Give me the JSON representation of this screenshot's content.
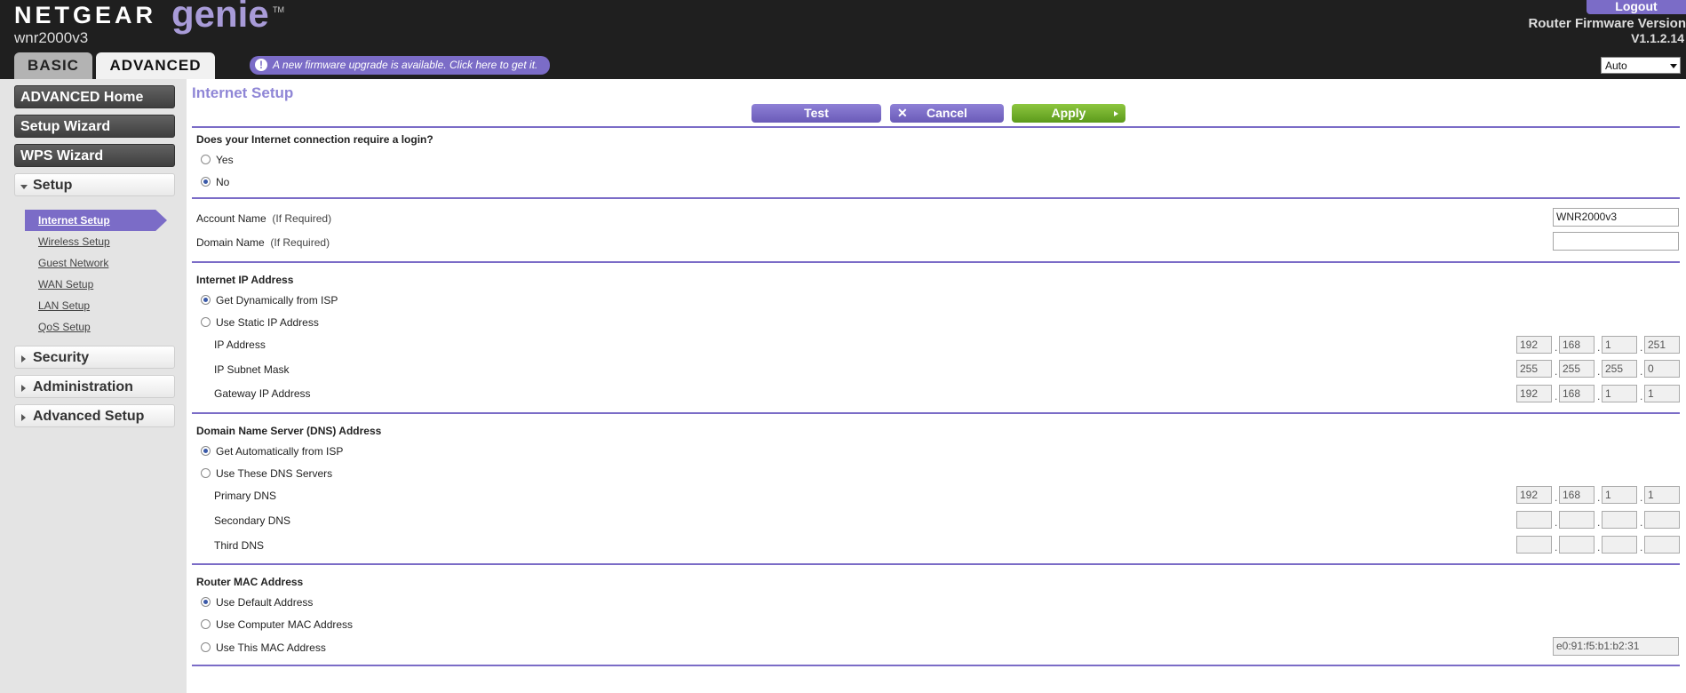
{
  "header": {
    "brand": "NETGEAR",
    "product": "genie",
    "model": "wnr2000v3",
    "logout_label": "Logout",
    "firmware_label": "Router Firmware Version",
    "firmware_version": "V1.1.2.14",
    "tabs": [
      "BASIC",
      "ADVANCED"
    ],
    "notice": "A new firmware upgrade is available. Click here to get it.",
    "language": "Auto"
  },
  "sidebar": {
    "buttons": [
      "ADVANCED Home",
      "Setup Wizard",
      "WPS Wizard"
    ],
    "setup_label": "Setup",
    "setup_items": [
      "Internet Setup",
      "Wireless Setup",
      "Guest Network",
      "WAN Setup",
      "LAN Setup",
      "QoS Setup"
    ],
    "sections": [
      "Security",
      "Administration",
      "Advanced Setup"
    ]
  },
  "main": {
    "title": "Internet Setup",
    "buttons": {
      "test": "Test",
      "cancel": "Cancel",
      "apply": "Apply"
    },
    "login": {
      "question": "Does your Internet connection require a login?",
      "yes": "Yes",
      "no": "No"
    },
    "account": {
      "account_label": "Account Name",
      "domain_label": "Domain Name",
      "if_required": "(If Required)",
      "account_value": "WNR2000v3",
      "domain_value": ""
    },
    "ip": {
      "heading": "Internet IP Address",
      "dynamic": "Get Dynamically from ISP",
      "static": "Use Static IP Address",
      "ip_label": "IP Address",
      "mask_label": "IP Subnet Mask",
      "gateway_label": "Gateway IP Address",
      "ip_value": [
        "192",
        "168",
        "1",
        "251"
      ],
      "mask_value": [
        "255",
        "255",
        "255",
        "0"
      ],
      "gateway_value": [
        "192",
        "168",
        "1",
        "1"
      ]
    },
    "dns": {
      "heading": "Domain Name Server (DNS) Address",
      "auto": "Get Automatically from ISP",
      "manual": "Use These DNS Servers",
      "primary_label": "Primary DNS",
      "secondary_label": "Secondary DNS",
      "third_label": "Third DNS",
      "primary_value": [
        "192",
        "168",
        "1",
        "1"
      ],
      "secondary_value": [
        "",
        "",
        "",
        ""
      ],
      "third_value": [
        "",
        "",
        "",
        ""
      ]
    },
    "mac": {
      "heading": "Router MAC Address",
      "default": "Use Default Address",
      "computer": "Use Computer MAC Address",
      "custom": "Use This MAC Address",
      "value": "e0:91:f5:b1:b2:31"
    }
  },
  "colors": {
    "accent": "#7b6cc7",
    "apply": "#6aa82a",
    "header_bg": "#1f1f1f"
  }
}
